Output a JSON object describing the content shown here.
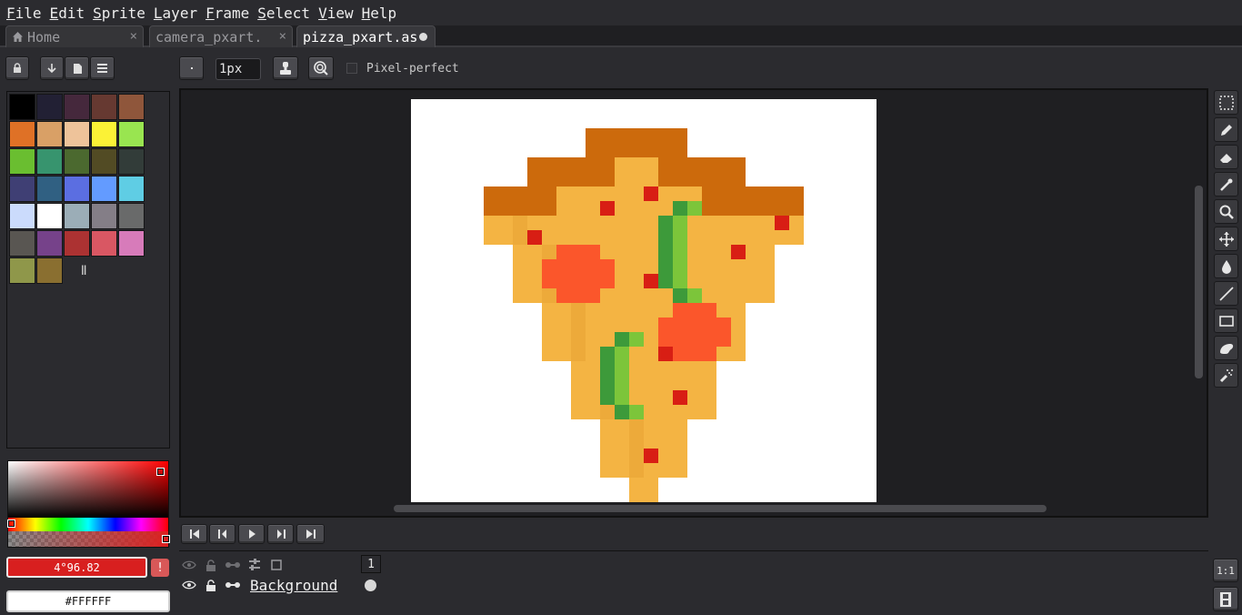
{
  "menu": [
    "File",
    "Edit",
    "Sprite",
    "Layer",
    "Frame",
    "Select",
    "View",
    "Help"
  ],
  "tabs": {
    "home": "Home",
    "camera": "camera_pxart.",
    "pizza": "pizza_pxart.as",
    "close_glyph": "×"
  },
  "tool_options": {
    "brush_size": "1px",
    "pixel_perfect": "Pixel-perfect",
    "pixel_perfect_checked": false
  },
  "palette": [
    "#000000",
    "#222034",
    "#45283c",
    "#663931",
    "#8f563b",
    "#df7126",
    "#d9a066",
    "#eec39a",
    "#fbf236",
    "#99e550",
    "#6abe30",
    "#37946e",
    "#4b692f",
    "#524b24",
    "#323c39",
    "#3f3f74",
    "#306082",
    "#5b6ee1",
    "#639bff",
    "#5fcde4",
    "#cbdbfc",
    "#ffffff",
    "#9badb7",
    "#847e87",
    "#696a6a",
    "#595652",
    "#76428a",
    "#ac3232",
    "#d95763",
    "#d77bba",
    "#8f974a",
    "#8a6f30"
  ],
  "palette_more": "ǁ",
  "colors": {
    "foreground": "4°96.82",
    "background": "#FFFFFF",
    "swap_glyph": "!"
  },
  "timeline": {
    "layer_name": "Background",
    "frame_number": "1",
    "zoom_label": "1:1"
  }
}
